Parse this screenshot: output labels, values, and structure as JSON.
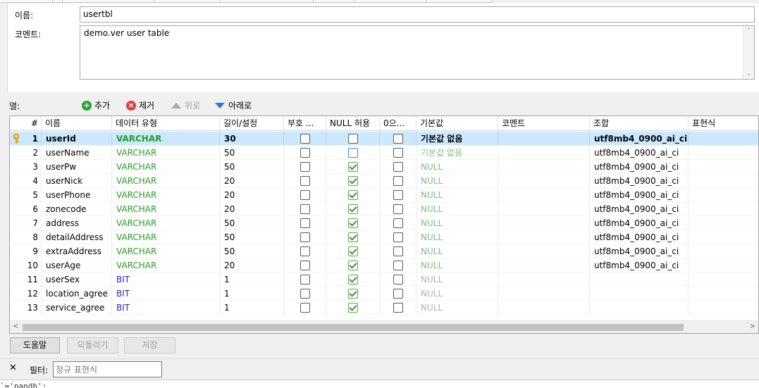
{
  "form": {
    "name_label": "이름:",
    "name_value": "usertbl",
    "comment_label": "코멘트:",
    "comment_value": "demo.ver user table"
  },
  "toolbar": {
    "columns_label": "열:",
    "add": "추가",
    "remove": "제거",
    "up": "위로",
    "down": "아래로"
  },
  "grid": {
    "headers": [
      "#",
      "이름",
      "데이터 유형",
      "길이/설정",
      "부호 ...",
      "NULL 허용",
      "0으...",
      "기본값",
      "코멘트",
      "조합",
      "표현식"
    ],
    "rows": [
      {
        "n": "1",
        "name": "userId",
        "type": "VARCHAR",
        "len": "30",
        "unsigned": false,
        "nullable": false,
        "zerofill": false,
        "default": "기본값 없음",
        "comment": "",
        "collation": "utf8mb4_0900_ai_ci",
        "expr": ""
      },
      {
        "n": "2",
        "name": "userName",
        "type": "VARCHAR",
        "len": "50",
        "unsigned": false,
        "nullable": false,
        "zerofill": false,
        "default": "기본값 없음",
        "comment": "",
        "collation": "utf8mb4_0900_ai_ci",
        "expr": ""
      },
      {
        "n": "3",
        "name": "userPw",
        "type": "VARCHAR",
        "len": "50",
        "unsigned": false,
        "nullable": true,
        "zerofill": false,
        "default": "NULL",
        "comment": "",
        "collation": "utf8mb4_0900_ai_ci",
        "expr": ""
      },
      {
        "n": "4",
        "name": "userNick",
        "type": "VARCHAR",
        "len": "20",
        "unsigned": false,
        "nullable": true,
        "zerofill": false,
        "default": "NULL",
        "comment": "",
        "collation": "utf8mb4_0900_ai_ci",
        "expr": ""
      },
      {
        "n": "5",
        "name": "userPhone",
        "type": "VARCHAR",
        "len": "20",
        "unsigned": false,
        "nullable": true,
        "zerofill": false,
        "default": "NULL",
        "comment": "",
        "collation": "utf8mb4_0900_ai_ci",
        "expr": ""
      },
      {
        "n": "6",
        "name": "zonecode",
        "type": "VARCHAR",
        "len": "20",
        "unsigned": false,
        "nullable": true,
        "zerofill": false,
        "default": "NULL",
        "comment": "",
        "collation": "utf8mb4_0900_ai_ci",
        "expr": ""
      },
      {
        "n": "7",
        "name": "address",
        "type": "VARCHAR",
        "len": "50",
        "unsigned": false,
        "nullable": true,
        "zerofill": false,
        "default": "NULL",
        "comment": "",
        "collation": "utf8mb4_0900_ai_ci",
        "expr": ""
      },
      {
        "n": "8",
        "name": "detailAddress",
        "type": "VARCHAR",
        "len": "50",
        "unsigned": false,
        "nullable": true,
        "zerofill": false,
        "default": "NULL",
        "comment": "",
        "collation": "utf8mb4_0900_ai_ci",
        "expr": ""
      },
      {
        "n": "9",
        "name": "extraAddress",
        "type": "VARCHAR",
        "len": "50",
        "unsigned": false,
        "nullable": true,
        "zerofill": false,
        "default": "NULL",
        "comment": "",
        "collation": "utf8mb4_0900_ai_ci",
        "expr": ""
      },
      {
        "n": "10",
        "name": "userAge",
        "type": "VARCHAR",
        "len": "20",
        "unsigned": false,
        "nullable": true,
        "zerofill": false,
        "default": "NULL",
        "comment": "",
        "collation": "utf8mb4_0900_ai_ci",
        "expr": ""
      },
      {
        "n": "11",
        "name": "userSex",
        "type": "BIT",
        "len": "1",
        "unsigned": false,
        "nullable": true,
        "zerofill": false,
        "default": "NULL",
        "comment": "",
        "collation": "",
        "expr": ""
      },
      {
        "n": "12",
        "name": "location_agree",
        "type": "BIT",
        "len": "1",
        "unsigned": false,
        "nullable": true,
        "zerofill": false,
        "default": "NULL",
        "comment": "",
        "collation": "",
        "expr": ""
      },
      {
        "n": "13",
        "name": "service_agree",
        "type": "BIT",
        "len": "1",
        "unsigned": false,
        "nullable": true,
        "zerofill": false,
        "default": "NULL",
        "comment": "",
        "collation": "",
        "expr": ""
      }
    ],
    "selected_row": 0,
    "colors": {
      "varchar": "#22a022",
      "bit": "#2626c8",
      "selection": "#cce8ff",
      "primary_key": "#e8a317"
    }
  },
  "buttons": {
    "help": "도움말",
    "revert": "되돌리기",
    "save": "저장"
  },
  "filter": {
    "close": "✕",
    "label": "필터:",
    "placeholder": "정규 표현식"
  },
  "sql_preview": "`='pandb';"
}
